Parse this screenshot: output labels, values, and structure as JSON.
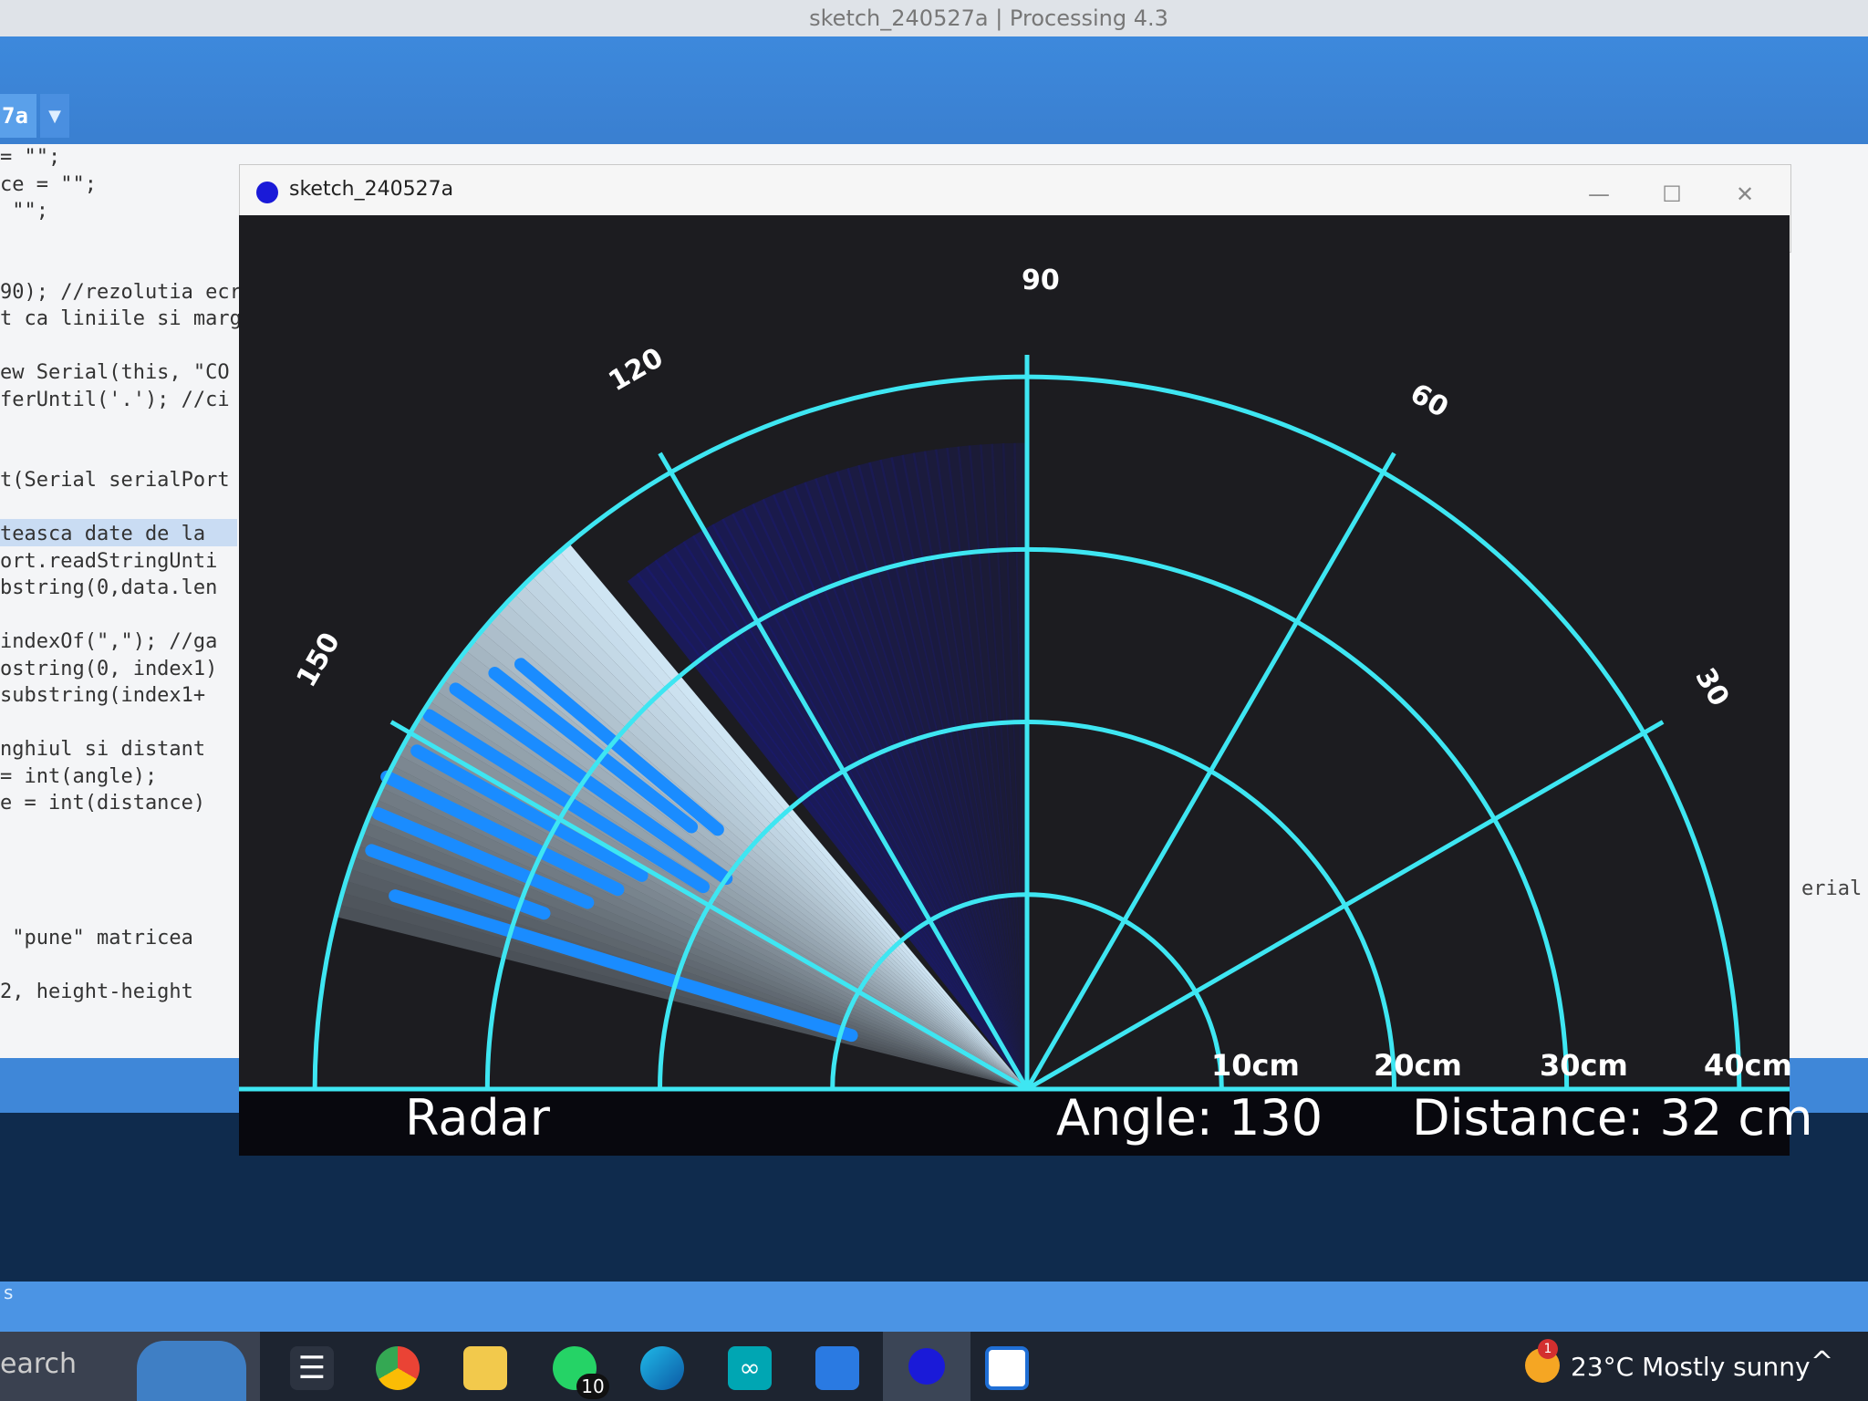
{
  "ide": {
    "title": "sketch_240527a | Processing 4.3",
    "tab_label": "7a",
    "tab_menu_icon": "chevron-down-icon",
    "code_lines": [
      "= \"\";",
      "ce = \"\";",
      " \"\";",
      "",
      "",
      "90); //rezolutia ecr",
      "t ca liniile si marg",
      "",
      "ew Serial(this, \"CO",
      "ferUntil('.'); //ci",
      "",
      "",
      "t(Serial serialPort",
      "",
      "teasca date de la ",
      "ort.readStringUnti",
      "bstring(0,data.len",
      "",
      "indexOf(\",\"); //ga",
      "ostring(0, index1)",
      "substring(index1+",
      "",
      "nghiul si distant",
      "= int(angle);",
      "e = int(distance)",
      "",
      "",
      "",
      "",
      " \"pune\" matricea",
      "",
      "2, height-height"
    ],
    "right_fragment": "erial",
    "status_fragment": "s"
  },
  "sketch": {
    "title": "sketch_240527a",
    "minimize_icon": "minimize-icon",
    "maximize_icon": "maximize-icon",
    "close_icon": "close-icon"
  },
  "radar": {
    "title": "Radar",
    "angle_text": "Angle: 130",
    "distance_text": "Distance: 32 cm",
    "range_labels": [
      "10cm",
      "20cm",
      "30cm",
      "40cm"
    ],
    "angle_labels": [
      "30",
      "60",
      "90",
      "120",
      "150"
    ],
    "current_angle": 130,
    "current_distance_cm": 32,
    "colors": {
      "grid": "#3ee6f2",
      "background": "#1c1c20",
      "object": "#1a8cff",
      "sweep": "#d9f0ff"
    }
  },
  "taskbar": {
    "search_text": "earch",
    "search_icon": "search-icon",
    "icons": [
      "task-view-icon",
      "chrome-icon",
      "file-explorer-icon",
      "whatsapp-icon",
      "edge-icon",
      "arduino-icon",
      "remote-desktop-icon",
      "processing-icon",
      "notepad-icon"
    ],
    "whatsapp_badge": "10",
    "weather_badge": "1",
    "weather_text": "23°C  Mostly sunny",
    "tray_chevron": "^"
  }
}
